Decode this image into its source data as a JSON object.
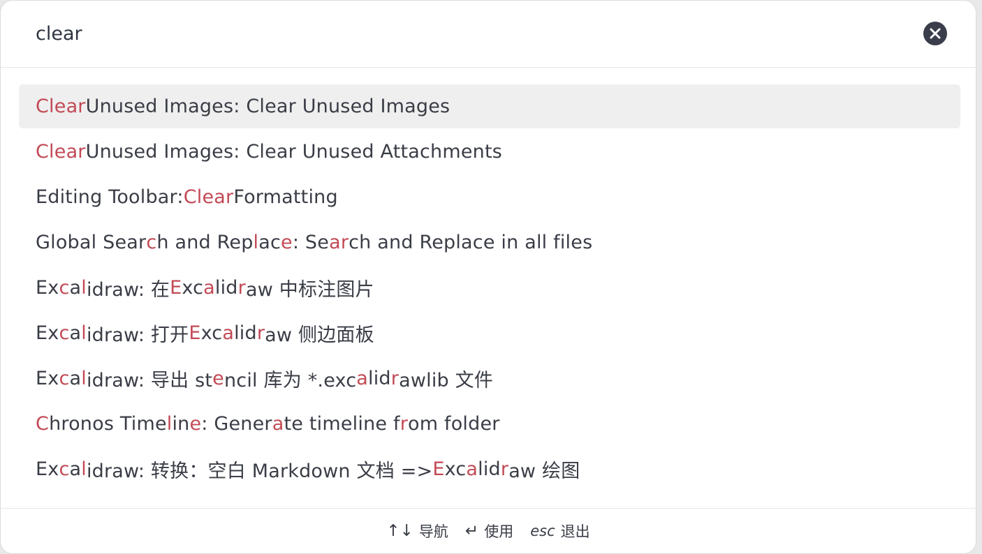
{
  "search": {
    "value": "clear",
    "clear_icon": "close-circle-icon"
  },
  "colors": {
    "highlight": "#c24a55",
    "text": "#3a3d46",
    "selected_bg": "#efefef"
  },
  "results": [
    {
      "selected": true,
      "segments": [
        {
          "t": "Clear",
          "h": true
        },
        {
          "t": " Unused Images: Clear Unused Images",
          "h": false
        }
      ]
    },
    {
      "selected": false,
      "segments": [
        {
          "t": "Clear",
          "h": true
        },
        {
          "t": " Unused Images: Clear Unused Attachments",
          "h": false
        }
      ]
    },
    {
      "selected": false,
      "segments": [
        {
          "t": "Editing Toolbar: ",
          "h": false
        },
        {
          "t": "Clear",
          "h": true
        },
        {
          "t": " Formatting",
          "h": false
        }
      ]
    },
    {
      "selected": false,
      "segments": [
        {
          "t": "Global Sear",
          "h": false
        },
        {
          "t": "c",
          "h": true
        },
        {
          "t": "h and Rep",
          "h": false
        },
        {
          "t": "l",
          "h": true
        },
        {
          "t": "ac",
          "h": false
        },
        {
          "t": "e",
          "h": true
        },
        {
          "t": ": Se",
          "h": false
        },
        {
          "t": "ar",
          "h": true
        },
        {
          "t": "ch and Replace in all files",
          "h": false
        }
      ]
    },
    {
      "selected": false,
      "segments": [
        {
          "t": "Ex",
          "h": false
        },
        {
          "t": "c",
          "h": true
        },
        {
          "t": "a",
          "h": false
        },
        {
          "t": "l",
          "h": true
        },
        {
          "t": "idraw: 在 ",
          "h": false
        },
        {
          "t": "E",
          "h": true
        },
        {
          "t": "xc",
          "h": false
        },
        {
          "t": "a",
          "h": true
        },
        {
          "t": "lid",
          "h": false
        },
        {
          "t": "r",
          "h": true
        },
        {
          "t": "aw 中标注图片",
          "h": false
        }
      ]
    },
    {
      "selected": false,
      "segments": [
        {
          "t": "Ex",
          "h": false
        },
        {
          "t": "c",
          "h": true
        },
        {
          "t": "a",
          "h": false
        },
        {
          "t": "l",
          "h": true
        },
        {
          "t": "idraw: 打开 ",
          "h": false
        },
        {
          "t": "E",
          "h": true
        },
        {
          "t": "xc",
          "h": false
        },
        {
          "t": "a",
          "h": true
        },
        {
          "t": "lid",
          "h": false
        },
        {
          "t": "r",
          "h": true
        },
        {
          "t": "aw 侧边面板",
          "h": false
        }
      ]
    },
    {
      "selected": false,
      "segments": [
        {
          "t": "Ex",
          "h": false
        },
        {
          "t": "c",
          "h": true
        },
        {
          "t": "a",
          "h": false
        },
        {
          "t": "l",
          "h": true
        },
        {
          "t": "idraw: 导出 st",
          "h": false
        },
        {
          "t": "e",
          "h": true
        },
        {
          "t": "ncil 库为 *.exc",
          "h": false
        },
        {
          "t": "a",
          "h": true
        },
        {
          "t": "lid",
          "h": false
        },
        {
          "t": "r",
          "h": true
        },
        {
          "t": "awlib 文件",
          "h": false
        }
      ]
    },
    {
      "selected": false,
      "segments": [
        {
          "t": "C",
          "h": true
        },
        {
          "t": "hronos Time",
          "h": false
        },
        {
          "t": "l",
          "h": true
        },
        {
          "t": "in",
          "h": false
        },
        {
          "t": "e",
          "h": true
        },
        {
          "t": ": Gener",
          "h": false
        },
        {
          "t": "a",
          "h": true
        },
        {
          "t": "te timeline f",
          "h": false
        },
        {
          "t": "r",
          "h": true
        },
        {
          "t": "om folder",
          "h": false
        }
      ]
    },
    {
      "selected": false,
      "segments": [
        {
          "t": "Ex",
          "h": false
        },
        {
          "t": "c",
          "h": true
        },
        {
          "t": "a",
          "h": false
        },
        {
          "t": "l",
          "h": true
        },
        {
          "t": "idraw: 转换：空白 Markdown 文档 => ",
          "h": false
        },
        {
          "t": "E",
          "h": true
        },
        {
          "t": "xc",
          "h": false
        },
        {
          "t": "a",
          "h": true
        },
        {
          "t": "lid",
          "h": false
        },
        {
          "t": "r",
          "h": true
        },
        {
          "t": "aw 绘图",
          "h": false
        }
      ]
    }
  ],
  "footer": {
    "navigate_key": "↑↓",
    "navigate_label": "导航",
    "use_key": "↵",
    "use_label": "使用",
    "esc_key": "esc",
    "esc_label": "退出"
  }
}
